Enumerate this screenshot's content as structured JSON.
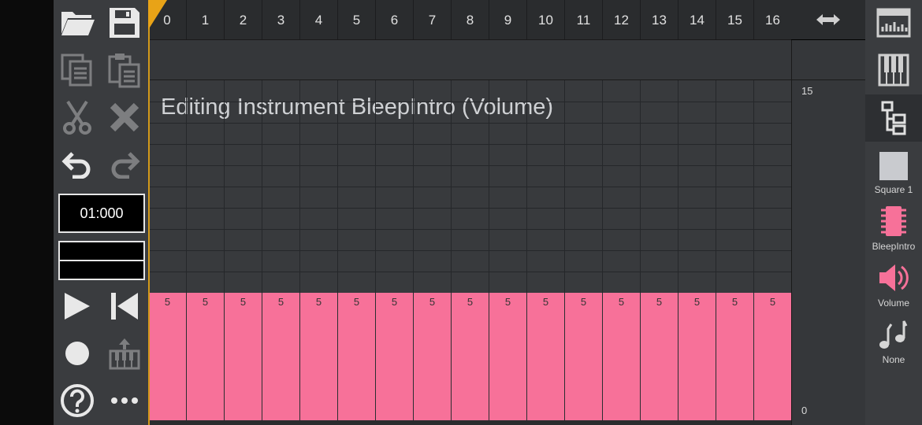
{
  "time_display": "01:000",
  "ruler": {
    "columns": [
      "0",
      "1",
      "2",
      "3",
      "4",
      "5",
      "6",
      "7",
      "8",
      "9",
      "10",
      "11",
      "12",
      "13",
      "14",
      "15",
      "16"
    ],
    "resize_icon": "left-right-arrows-icon"
  },
  "editor": {
    "title": "Editing Instrument BleepIntro (Volume)",
    "scale_max": "15",
    "scale_min": "0",
    "bar_values": [
      5,
      5,
      5,
      5,
      5,
      5,
      5,
      5,
      5,
      5,
      5,
      5,
      5,
      5,
      5,
      5,
      5
    ],
    "bar_labels": [
      "5",
      "5",
      "5",
      "5",
      "5",
      "5",
      "5",
      "5",
      "5",
      "5",
      "5",
      "5",
      "5",
      "5",
      "5",
      "5",
      "5"
    ],
    "bar_color": "#f77199"
  },
  "toolbar": {
    "icons": [
      "open-folder-icon",
      "save-icon",
      "copy-icon",
      "paste-icon",
      "cut-icon",
      "delete-icon",
      "undo-icon",
      "redo-icon",
      "play-icon",
      "rewind-icon",
      "record-icon",
      "piano-upload-icon",
      "help-icon",
      "more-icon"
    ]
  },
  "sidebar": {
    "items": [
      {
        "icon": "sequencer-icon",
        "label": ""
      },
      {
        "icon": "piano-icon",
        "label": ""
      },
      {
        "icon": "hierarchy-icon",
        "label": ""
      },
      {
        "icon": "square-wave-icon",
        "label": "Square 1"
      },
      {
        "icon": "chip-icon",
        "label": "BleepIntro"
      },
      {
        "icon": "speaker-icon",
        "label": "Volume"
      },
      {
        "icon": "music-notes-icon",
        "label": "None"
      }
    ]
  },
  "colors": {
    "accent": "#f77199",
    "playhead": "#e8a317",
    "background": "#383a3d"
  }
}
